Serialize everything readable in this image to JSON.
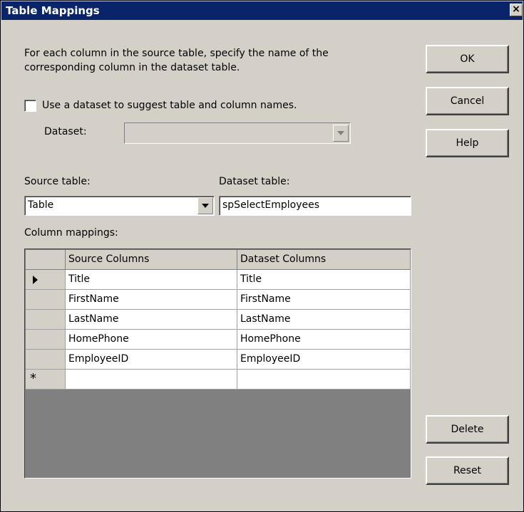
{
  "dialog": {
    "title": "Table Mappings",
    "close_label": "×",
    "description_line1": "For each column in the source table, specify the name of the",
    "description_line2": "corresponding column in the dataset table."
  },
  "buttons": {
    "ok": "OK",
    "cancel": "Cancel",
    "help": "Help",
    "delete": "Delete",
    "reset": "Reset"
  },
  "options": {
    "use_dataset_label": "Use a dataset to suggest table and column names.",
    "use_dataset_checked": false,
    "dataset_label": "Dataset:",
    "dataset_value": ""
  },
  "source_table": {
    "label": "Source table:",
    "value": "Table"
  },
  "dataset_table": {
    "label": "Dataset table:",
    "value": "spSelectEmployees"
  },
  "column_mappings": {
    "label": "Column mappings:",
    "headers": [
      "",
      "Source Columns",
      "Dataset Columns"
    ],
    "rows": [
      {
        "source": "Title",
        "dataset": "Title"
      },
      {
        "source": "FirstName",
        "dataset": "FirstName"
      },
      {
        "source": "LastName",
        "dataset": "LastName"
      },
      {
        "source": "HomePhone",
        "dataset": "HomePhone"
      },
      {
        "source": "EmployeeID",
        "dataset": "EmployeeID"
      }
    ],
    "new_row_marker": "*",
    "current_row_indicator": "triangle-right-icon"
  },
  "colors": {
    "titlebar": "#0a246a",
    "face": "#d4d0c8",
    "grid_empty": "#808080"
  }
}
